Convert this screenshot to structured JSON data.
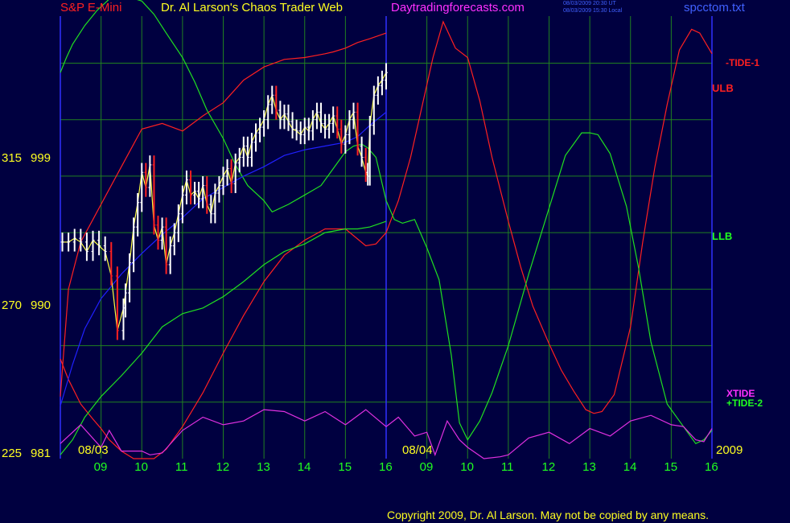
{
  "header": {
    "symbol": "S&P E-Mini",
    "title": "Dr. Al Larson's Chaos Trader Web",
    "site": "Daytradingforecasts.com",
    "stamp_utc": "08/03/2009 20:30 UT",
    "stamp_local": "08/03/2009 15:30 Local",
    "file": "spcctom.txt"
  },
  "footer": {
    "copyright": "Copyright 2009, Dr. Al Larson. May not be copied by any means."
  },
  "colors": {
    "background": "#000040",
    "grid": "#208020",
    "price_bars": "#ffffff",
    "down_bars": "#ff2020",
    "tide1": "#ff2020",
    "tide2": "#20e020",
    "xtide": "#e030e0",
    "moving_average": "#2020ff",
    "short_average": "#ffff40",
    "divider": "#3030ff"
  },
  "chart_data": {
    "type": "line",
    "x_axis": {
      "day_labels": [
        "08/03",
        "08/04"
      ],
      "hour_ticks": [
        "09",
        "10",
        "11",
        "12",
        "13",
        "14",
        "15",
        "16",
        "09",
        "10",
        "11",
        "12",
        "13",
        "14",
        "15",
        "16"
      ],
      "year_label": "2009"
    },
    "y_axis": {
      "price_scale": [
        "999",
        "990",
        "981"
      ],
      "angle_scale": [
        "315",
        "270",
        "225"
      ],
      "ylim": [
        981,
        1004.5
      ]
    },
    "right_labels": [
      "-TIDE-1",
      "ULB",
      "LLB",
      "XTIDE",
      "+TIDE-2"
    ],
    "series": [
      {
        "name": "-TIDE-1",
        "x": [
          0,
          0.2,
          0.5,
          0.8,
          1,
          1.2,
          1.5,
          1.8,
          2,
          2.3,
          2.6,
          3,
          3.5,
          4,
          4.5,
          5,
          5.5,
          6,
          6.5,
          7,
          7.5,
          7.75,
          8,
          8.3,
          8.6,
          9.15,
          9.4,
          9.7,
          10,
          10.3,
          10.6,
          11,
          11.3,
          11.6,
          12,
          12.3,
          12.6,
          12.9,
          13.1,
          13.3,
          13.6,
          14,
          14.3,
          14.6,
          14.9,
          15.2,
          15.5,
          15.7,
          16
        ],
        "y": [
          986.3,
          985.2,
          983.9,
          983.1,
          982.6,
          982,
          981.4,
          981,
          981,
          981,
          981.5,
          982.7,
          984.5,
          986.6,
          988.6,
          990.4,
          991.8,
          992.6,
          993.2,
          993.2,
          992.3,
          992.4,
          993,
          994.7,
          997,
          1002.3,
          1004.2,
          1002.8,
          1002.3,
          1000,
          997,
          993.6,
          991.2,
          989.1,
          987.1,
          985.7,
          984.6,
          983.6,
          983.4,
          983.5,
          984.4,
          988,
          992.5,
          996.5,
          999.8,
          1002.7,
          1003.8,
          1003.6,
          1002.5
        ]
      },
      {
        "name": "ULB",
        "x": [
          0,
          0.2,
          0.5,
          0.8,
          1,
          1.5,
          2,
          2.5,
          3,
          3.5,
          4,
          4.5,
          5,
          5.5,
          6,
          6.5,
          6.7,
          7,
          7.3,
          7.6,
          8
        ],
        "y": [
          984.3,
          990,
          992.5,
          993.7,
          994.5,
          996.5,
          998.5,
          998.8,
          998.4,
          999.2,
          999.9,
          1001.1,
          1001.8,
          1002.2,
          1002.3,
          1002.5,
          1002.6,
          1002.8,
          1003.1,
          1003.3,
          1003.6
        ]
      },
      {
        "name": "+TIDE-2",
        "x": [
          0,
          0.15,
          0.3,
          0.6,
          0.9,
          1.2,
          1.5,
          1.7,
          2,
          2.3,
          2.6,
          3,
          3.3,
          3.6,
          4,
          4.3,
          4.6,
          5,
          5.2,
          5.6,
          6,
          6.4,
          6.7,
          7,
          7.2,
          7.4,
          7.55,
          7.75,
          8,
          8.2,
          8.4,
          8.7,
          9,
          9.3,
          9.6,
          9.8,
          10,
          10.3,
          10.6,
          11,
          11.5,
          12,
          12.4,
          12.8,
          13,
          13.2,
          13.5,
          13.9,
          14.2,
          14.5,
          14.9,
          15.2,
          15.6,
          15.8,
          16
        ],
        "y": [
          1001.5,
          1002.3,
          1003,
          1004,
          1004.8,
          1005.4,
          1005.5,
          1005.5,
          1005.3,
          1004.6,
          1003.6,
          1002.3,
          1001,
          999.5,
          998,
          996.6,
          995.5,
          994.7,
          994.1,
          994.5,
          995,
          995.5,
          996.4,
          997.3,
          997.6,
          997.7,
          997.5,
          997,
          994.7,
          993.7,
          993.5,
          993.7,
          992.2,
          990.5,
          986.5,
          982.9,
          982,
          983,
          984.5,
          987,
          990.8,
          994.3,
          997.1,
          998.3,
          998.3,
          998.2,
          997.2,
          994.4,
          991.1,
          987.2,
          983.9,
          983,
          981.8,
          982,
          982.5
        ]
      },
      {
        "name": "LLB",
        "x": [
          0,
          0.3,
          0.6,
          1,
          1.5,
          2,
          2.5,
          3,
          3.5,
          4,
          4.5,
          5,
          5.5,
          6,
          6.5,
          7,
          7.3,
          7.6,
          8
        ],
        "y": [
          981.2,
          982,
          983.2,
          984.3,
          985.4,
          986.6,
          988,
          988.7,
          989,
          989.6,
          990.4,
          991.3,
          992,
          992.4,
          993,
          993.2,
          993.2,
          993.3,
          993.6
        ]
      },
      {
        "name": "XTIDE",
        "x": [
          0,
          0.5,
          1,
          1.2,
          1.5,
          2,
          2.2,
          2.5,
          3,
          3.5,
          4,
          4.5,
          5,
          5.5,
          6,
          6.5,
          7,
          7.5,
          8,
          8.3,
          8.7,
          9,
          9.2,
          9.5,
          9.8,
          10,
          10.4,
          10.8,
          11,
          11.5,
          12,
          12.5,
          13,
          13.5,
          14,
          14.5,
          15,
          15.3,
          15.6,
          15.8,
          16
        ],
        "y": [
          981.8,
          982.8,
          981.6,
          982.5,
          981.4,
          981.4,
          981.2,
          981.3,
          982.5,
          983.2,
          982.8,
          983,
          983.6,
          983.5,
          983,
          983.5,
          982.8,
          983.6,
          982.7,
          983.2,
          982.2,
          982.4,
          981.2,
          983,
          982,
          981.6,
          981,
          981.1,
          981.2,
          982.1,
          982.4,
          981.8,
          982.6,
          982.2,
          983,
          983.3,
          982.8,
          982.7,
          982,
          981.9,
          982.6
        ]
      },
      {
        "name": "moving_average",
        "x": [
          0,
          0.3,
          0.6,
          1,
          1.5,
          2,
          2.5,
          3,
          3.5,
          4,
          4.5,
          5,
          5.5,
          6,
          6.5,
          7,
          7.3,
          7.6,
          8
        ],
        "y": [
          983.8,
          986,
          987.9,
          989.5,
          990.8,
          991.9,
          992.9,
          993.8,
          994.8,
          995.4,
          996,
          996.5,
          997.1,
          997.4,
          997.6,
          997.8,
          998.1,
          998.7,
          999.4
        ]
      },
      {
        "name": "price_close",
        "x": [
          0.05,
          0.2,
          0.35,
          0.5,
          0.65,
          0.8,
          0.95,
          1.1,
          1.25,
          1.4,
          1.55,
          1.6,
          1.7,
          1.8,
          1.9,
          2,
          2.1,
          2.2,
          2.3,
          2.4,
          2.5,
          2.6,
          2.7,
          2.8,
          2.9,
          3,
          3.1,
          3.2,
          3.3,
          3.4,
          3.5,
          3.6,
          3.7,
          3.8,
          3.9,
          4,
          4.1,
          4.2,
          4.3,
          4.4,
          4.5,
          4.6,
          4.7,
          4.8,
          4.9,
          5,
          5.1,
          5.2,
          5.3,
          5.4,
          5.5,
          5.6,
          5.7,
          5.8,
          5.9,
          6,
          6.1,
          6.2,
          6.3,
          6.4,
          6.5,
          6.6,
          6.7,
          6.8,
          6.9,
          7,
          7.1,
          7.2,
          7.3,
          7.4,
          7.5,
          7.55,
          7.6,
          7.7,
          7.8,
          7.9,
          8
        ],
        "y": [
          992.5,
          992.5,
          992.7,
          992.5,
          992,
          992.6,
          992.3,
          992,
          990.7,
          987.8,
          989,
          989.8,
          991.4,
          993.3,
          994.6,
          996.2,
          995.4,
          996.6,
          993.4,
          992.6,
          993.3,
          991.3,
          992.3,
          993,
          994,
          995,
          995.8,
          995,
          995.2,
          994.8,
          995.5,
          994.5,
          994,
          995.1,
          995.5,
          996,
          996.4,
          995.6,
          996.7,
          997,
          997.6,
          997,
          997.8,
          998.3,
          998.6,
          999,
          999.8,
          1000.3,
          999.5,
          999,
          999.3,
          998.9,
          998.5,
          998.4,
          998.2,
          998.6,
          998.4,
          999,
          999.4,
          998.8,
          998.5,
          998.8,
          999.2,
          998.5,
          997.7,
          998.2,
          999,
          999.4,
          997.6,
          997,
          996.2,
          996,
          998.7,
          1000.3,
          1000.8,
          1001.1,
          1001.5
        ]
      }
    ],
    "grid": true
  }
}
